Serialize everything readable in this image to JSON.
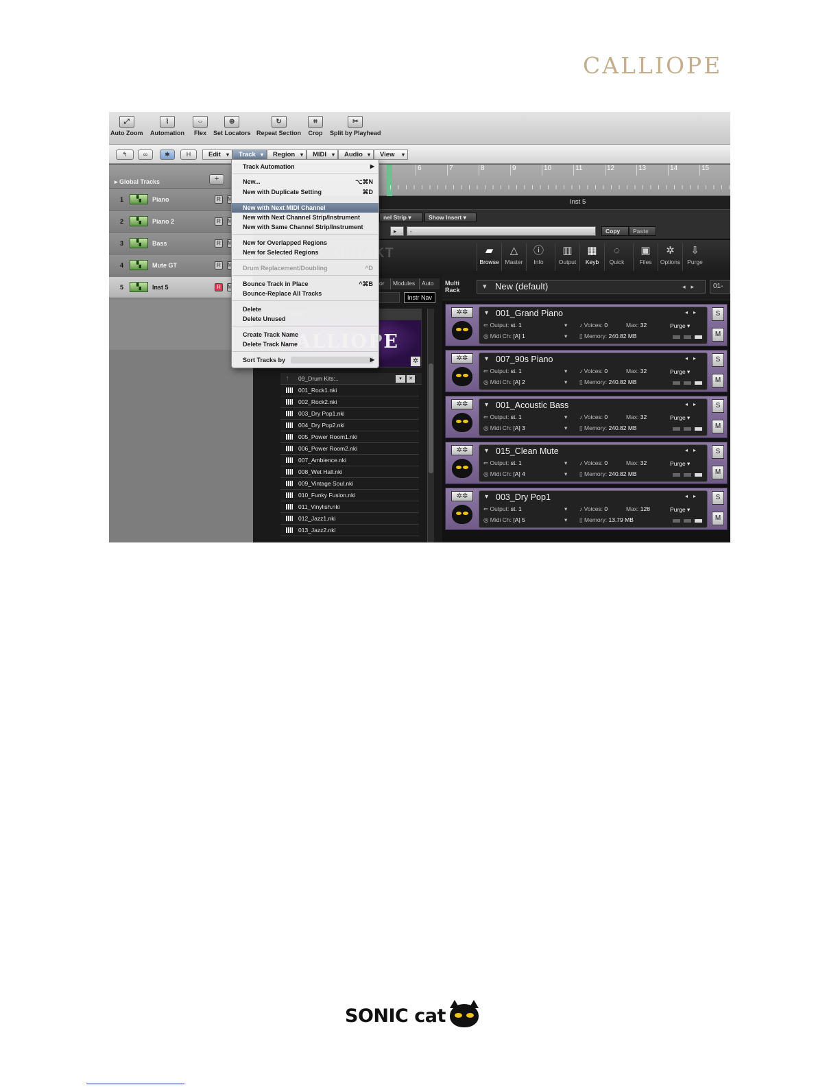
{
  "brand": {
    "title": "CALLIOPE",
    "footer_logo": "SONIC cat"
  },
  "toolbar": {
    "items": [
      {
        "label": "Auto Zoom",
        "icon": "auto-zoom-icon"
      },
      {
        "label": "Automation",
        "icon": "automation-icon"
      },
      {
        "label": "Flex",
        "icon": "flex-icon"
      },
      {
        "label": "Set Locators",
        "icon": "set-locators-icon"
      },
      {
        "label": "Repeat Section",
        "icon": "repeat-section-icon"
      },
      {
        "label": "Crop",
        "icon": "crop-icon"
      },
      {
        "label": "Split by Playhead",
        "icon": "split-icon"
      }
    ]
  },
  "menubar": {
    "h_button": "H",
    "menus": [
      "Edit",
      "Track",
      "Region",
      "MIDI",
      "Audio",
      "View"
    ]
  },
  "tracks": {
    "global_label": "Global Tracks",
    "add_button": "+",
    "rec": "R",
    "mute": "M",
    "items": [
      {
        "num": "1",
        "name": "Piano"
      },
      {
        "num": "2",
        "name": "Piano 2"
      },
      {
        "num": "3",
        "name": "Bass"
      },
      {
        "num": "4",
        "name": "Mute GT"
      },
      {
        "num": "5",
        "name": "Inst 5"
      }
    ]
  },
  "ruler": {
    "bars": [
      "6",
      "7",
      "8",
      "9",
      "10",
      "11",
      "12",
      "13",
      "14",
      "15"
    ]
  },
  "arrange": {
    "title": "Inst 5",
    "channel_strip": "nel Strip",
    "show_insert": "Show Insert",
    "dash": "-",
    "copy": "Copy",
    "paste": "Paste"
  },
  "track_menu": {
    "items": [
      {
        "label": "Track Automation",
        "submenu": true
      },
      {
        "label": "New...",
        "shortcut": "⌥⌘N"
      },
      {
        "label": "New with Duplicate Setting",
        "shortcut": "⌘D"
      },
      {
        "label": "New with Next MIDI Channel",
        "highlighted": true
      },
      {
        "label": "New with Next Channel Strip/Instrument"
      },
      {
        "label": "New with Same Channel Strip/Instrument"
      },
      {
        "label": "New for Overlapped Regions"
      },
      {
        "label": "New for Selected Regions"
      },
      {
        "label": "Drum Replacement/Doubling",
        "shortcut": "^D",
        "disabled": true
      },
      {
        "label": "Bounce Track in Place",
        "shortcut": "^⌘B"
      },
      {
        "label": "Bounce-Replace All Tracks"
      },
      {
        "label": "Delete"
      },
      {
        "label": "Delete Unused"
      },
      {
        "label": "Create Track Name"
      },
      {
        "label": "Delete Track Name"
      },
      {
        "label": "Sort Tracks by",
        "submenu": true
      }
    ]
  },
  "kontakt": {
    "logo": "ONTAKT",
    "buttons": [
      "Browse",
      "Master",
      "Info",
      "Output",
      "Keyb",
      "Quick",
      "Files",
      "Options",
      "Purge"
    ],
    "browser_tabs": [
      "or",
      "Modules",
      "Auto"
    ],
    "instr_nav": "Instr Nav",
    "library_label": "Calliope",
    "banner": "ALLIOPE",
    "folder": "09_Drum Kits:..",
    "files": [
      "001_Rock1.nki",
      "002_Rock2.nki",
      "003_Dry Pop1.nki",
      "004_Dry Pop2.nki",
      "005_Power Room1.nki",
      "006_Power Room2.nki",
      "007_Ambience.nki",
      "008_Wet Hall.nki",
      "009_Vintage Soul.nki",
      "010_Funky Fusion.nki",
      "011_Vinylish.nki",
      "012_Jazz1.nki",
      "013_Jazz2.nki"
    ],
    "rack": {
      "label1": "Multi",
      "label2": "Rack",
      "multi_name": "New (default)",
      "page": "01-",
      "output_label": "Output:",
      "midi_label": "Midi Ch:",
      "voices_label": "Voices:",
      "max_label": "Max:",
      "memory_label": "Memory:",
      "purge": "Purge",
      "solo": "S",
      "mute": "M",
      "instruments": [
        {
          "name": "001_Grand Piano",
          "output": "st. 1",
          "midi": "[A] 1",
          "voices": "0",
          "max": "32",
          "memory": "240.82 MB"
        },
        {
          "name": "007_90s Piano",
          "output": "st. 1",
          "midi": "[A] 2",
          "voices": "0",
          "max": "32",
          "memory": "240.82 MB"
        },
        {
          "name": "001_Acoustic Bass",
          "output": "st. 1",
          "midi": "[A] 3",
          "voices": "0",
          "max": "32",
          "memory": "240.82 MB"
        },
        {
          "name": "015_Clean Mute",
          "output": "st. 1",
          "midi": "[A] 4",
          "voices": "0",
          "max": "32",
          "memory": "240.82 MB"
        },
        {
          "name": "003_Dry Pop1",
          "output": "st. 1",
          "midi": "[A] 5",
          "voices": "0",
          "max": "128",
          "memory": "13.79 MB"
        }
      ]
    }
  },
  "colors": {
    "brand_gold": "#c4ae8c",
    "menu_highlight": "#6c8099",
    "rack_purple": "#7f6a98",
    "cat_eye": "#f0c419"
  }
}
